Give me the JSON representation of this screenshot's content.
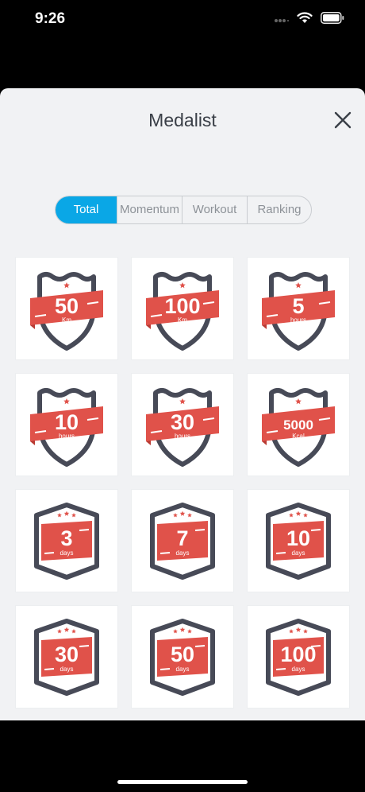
{
  "status_bar": {
    "time": "9:26"
  },
  "header": {
    "title": "Medalist"
  },
  "tabs": [
    {
      "label": "Total",
      "active": true
    },
    {
      "label": "Momentum",
      "active": false
    },
    {
      "label": "Workout",
      "active": false
    },
    {
      "label": "Ranking",
      "active": false
    }
  ],
  "medals": [
    {
      "value": "50",
      "unit": "Km",
      "shape": "shield"
    },
    {
      "value": "100",
      "unit": "Km",
      "shape": "shield"
    },
    {
      "value": "5",
      "unit": "hours",
      "shape": "shield"
    },
    {
      "value": "10",
      "unit": "hours",
      "shape": "shield"
    },
    {
      "value": "30",
      "unit": "hours",
      "shape": "shield"
    },
    {
      "value": "5000",
      "unit": "Kcal",
      "shape": "shield"
    },
    {
      "value": "3",
      "unit": "days",
      "shape": "hexagon"
    },
    {
      "value": "7",
      "unit": "days",
      "shape": "hexagon"
    },
    {
      "value": "10",
      "unit": "days",
      "shape": "hexagon"
    },
    {
      "value": "30",
      "unit": "days",
      "shape": "hexagon"
    },
    {
      "value": "50",
      "unit": "days",
      "shape": "hexagon"
    },
    {
      "value": "100",
      "unit": "days",
      "shape": "hexagon"
    }
  ],
  "colors": {
    "accent": "#0aa7e6",
    "ribbon": "#e0524a",
    "outline": "#474a57",
    "star": "#e0524a"
  }
}
